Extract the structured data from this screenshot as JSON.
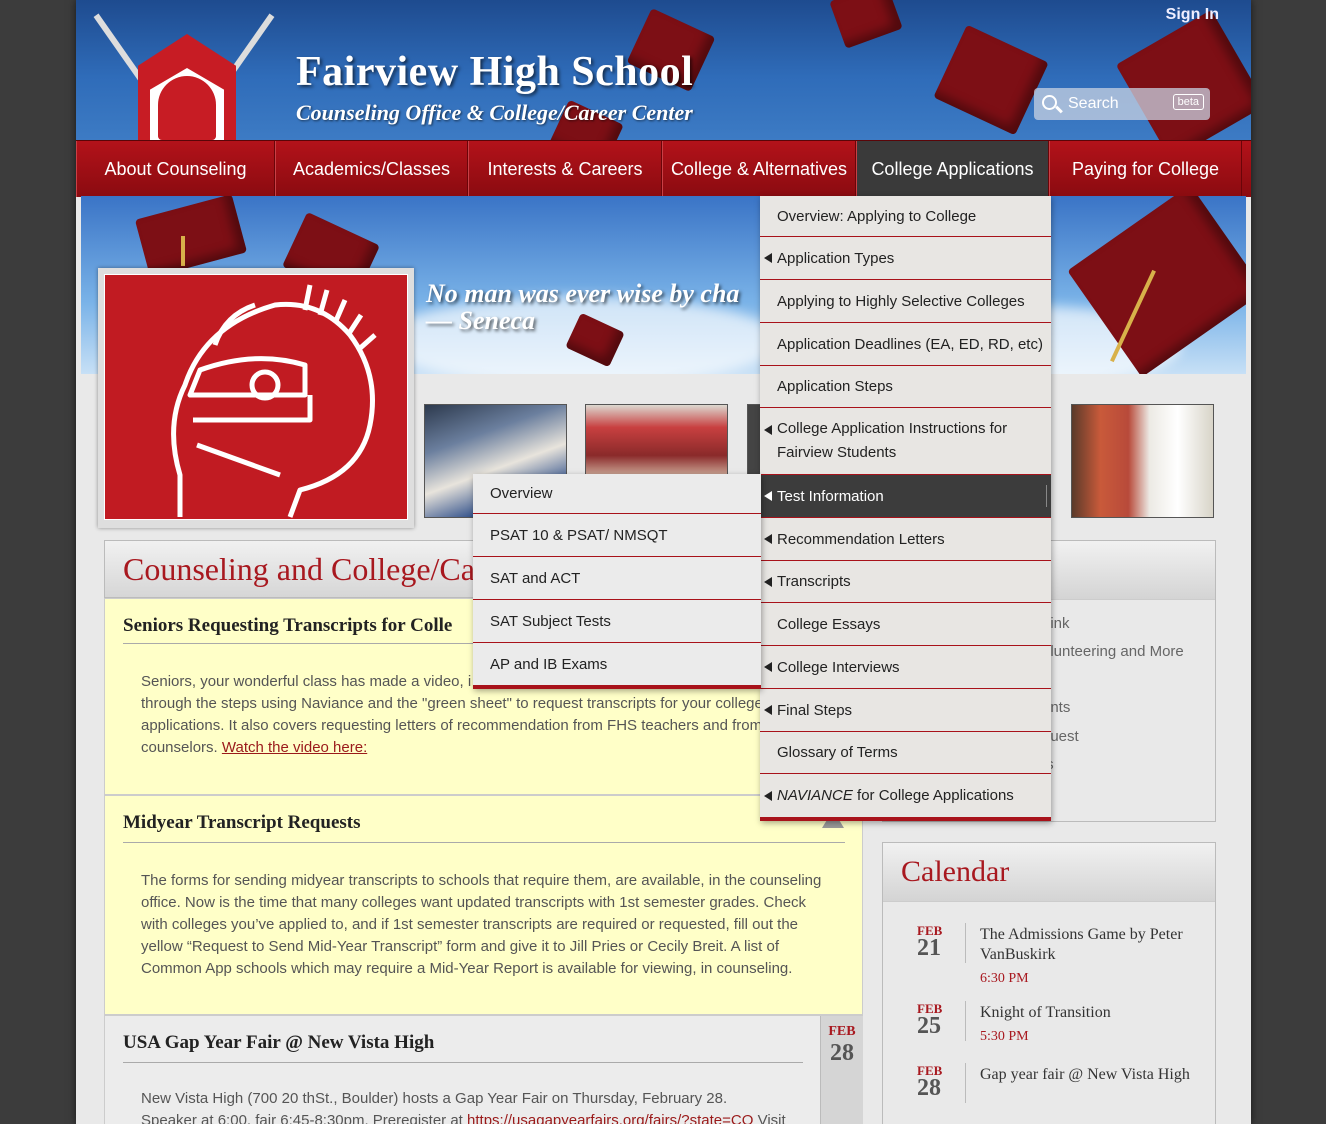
{
  "header": {
    "title": "Fairview High School",
    "subtitle": "Counseling Office & College/Career Center",
    "sign_in": "Sign In",
    "search_label": "Search",
    "search_badge": "beta"
  },
  "nav": {
    "items": [
      {
        "label": "About Counseling"
      },
      {
        "label": "Academics/Classes"
      },
      {
        "label": "Interests & Careers"
      },
      {
        "label": "College & Alternatives"
      },
      {
        "label": "College Applications"
      },
      {
        "label": "Paying for College"
      }
    ],
    "active_index": 4
  },
  "banner": {
    "quote_line1": "No man was ever wise by cha",
    "quote_line2": "— Seneca"
  },
  "dropdown": {
    "items": [
      {
        "label": "Overview: Applying to College",
        "has_sub": false
      },
      {
        "label": "Application Types",
        "has_sub": true
      },
      {
        "label": "Applying to Highly Selective Colleges",
        "has_sub": false
      },
      {
        "label": "Application Deadlines (EA, ED, RD, etc)",
        "has_sub": false
      },
      {
        "label": "Application Steps",
        "has_sub": false
      },
      {
        "label": "College Application Instructions for Fairview Students",
        "has_sub": true
      },
      {
        "label": "Test Information",
        "has_sub": true,
        "active": true
      },
      {
        "label": "Recommendation Letters",
        "has_sub": true
      },
      {
        "label": "Transcripts",
        "has_sub": true
      },
      {
        "label": "College Essays",
        "has_sub": false
      },
      {
        "label": "College Interviews",
        "has_sub": true
      },
      {
        "label": "Final Steps",
        "has_sub": true
      },
      {
        "label": "Glossary of Terms",
        "has_sub": false
      },
      {
        "label_em": "NAVIANCE",
        "label_rest": " for College Applications",
        "has_sub": true
      }
    ]
  },
  "subdropdown": {
    "items": [
      "Overview",
      "PSAT 10 & PSAT/ NMSQT",
      "SAT and ACT",
      "SAT Subject Tests",
      "AP and IB Exams"
    ]
  },
  "main": {
    "heading": "Counseling and College/Ca",
    "articles": [
      {
        "title": "Seniors Requesting Transcripts for Colle",
        "body": "Seniors, your wonderful class has made a video, i",
        "body_2": "through the steps using Naviance and the \"green sheet\" to request transcripts for your college",
        "body_3": "applications. It also covers requesting letters of recommendation from FHS teachers and from",
        "body_4": "counselors. ",
        "link": "Watch the video here:"
      },
      {
        "title": "Midyear Transcript Requests",
        "body_1": "The forms for sending midyear transcripts to schools that require them, are available, in the counseling",
        "body_2": "office. Now is the time that many colleges want updated transcripts with 1st semester grades. Check",
        "body_3": "with colleges you’ve applied to, and if 1st semester transcripts are required or requested, fill out the",
        "body_4": "yellow “Request to Send Mid-Year Transcript” form and give it to Jill Pries or Cecily Breit. A list of",
        "body_5": "Common App schools which may require a Mid-Year Report is available for viewing, in counseling."
      },
      {
        "title": "USA Gap Year Fair @ New Vista High",
        "body_1": "New Vista High (700 20 thSt., Boulder) hosts a Gap Year Fair on Thursday, February 28.",
        "body_2": "Speaker at 6:00, fair 6:45-8:30pm. Preregister at ",
        "link": "https://usagapyearfairs.org/fairs/?state=CO",
        "body_3": " Visit",
        "date_month": "FEB",
        "date_day": "28"
      }
    ]
  },
  "sidebar": {
    "links": [
      "Link",
      "olunteering and More",
      "ents",
      "quest",
      "ts"
    ]
  },
  "calendar": {
    "title": "Calendar",
    "events": [
      {
        "month": "FEB",
        "day": "21",
        "title": "The Admissions Game by Peter VanBuskirk",
        "time": "6:30 PM"
      },
      {
        "month": "FEB",
        "day": "25",
        "title": "Knight of Transition",
        "time": "5:30 PM"
      },
      {
        "month": "FEB",
        "day": "28",
        "title": "Gap year fair @ New Vista High",
        "time": ""
      }
    ]
  },
  "colors": {
    "brand_red": "#a8181f",
    "nav_red": "#b3121a",
    "dropdown_active": "#3c3c3c"
  }
}
